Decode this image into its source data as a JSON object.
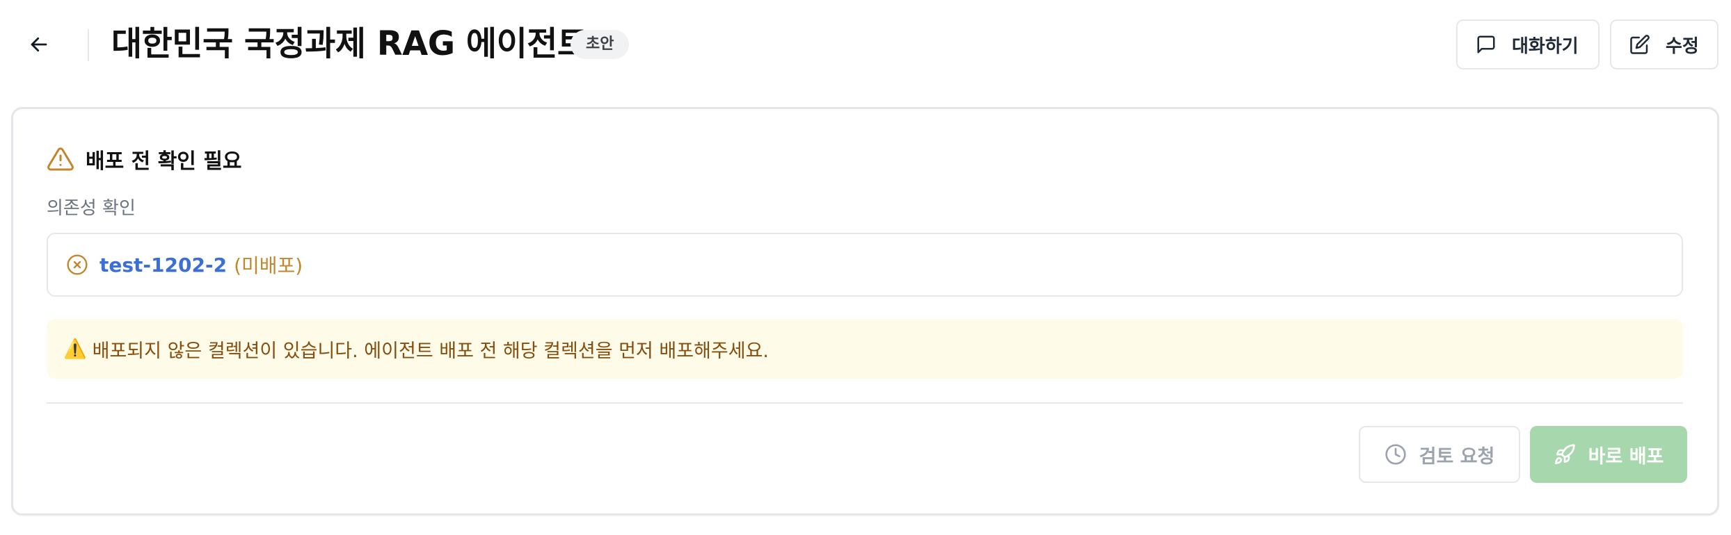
{
  "header": {
    "title": "대한민국 국정과제 RAG 에이전트",
    "status_badge": "초안",
    "chat_button": "대화하기",
    "edit_button": "수정"
  },
  "icons": {
    "back": "arrow-left-icon",
    "chat": "message-square-icon",
    "edit": "edit-icon",
    "warning": "alert-triangle-icon",
    "dependency_status": "x-circle-icon",
    "review": "clock-icon",
    "deploy": "rocket-icon"
  },
  "card": {
    "warning_title": "배포 전 확인 필요",
    "section_label": "의존성 확인",
    "dependencies": [
      {
        "name": "test-1202-2",
        "status": "(미배포)"
      }
    ],
    "notice_emoji": "⚠️",
    "notice_text": "배포되지 않은 컬렉션이 있습니다. 에이전트 배포 전 해당 컬렉션을 먼저 배포해주세요.",
    "review_button": "검토 요청",
    "deploy_button": "바로 배포"
  },
  "colors": {
    "link": "#3b6fd6",
    "warning": "#c2862f",
    "notice_bg": "#fefce8",
    "notice_text": "#854d0e",
    "deploy_disabled": "#a7d7ad"
  }
}
